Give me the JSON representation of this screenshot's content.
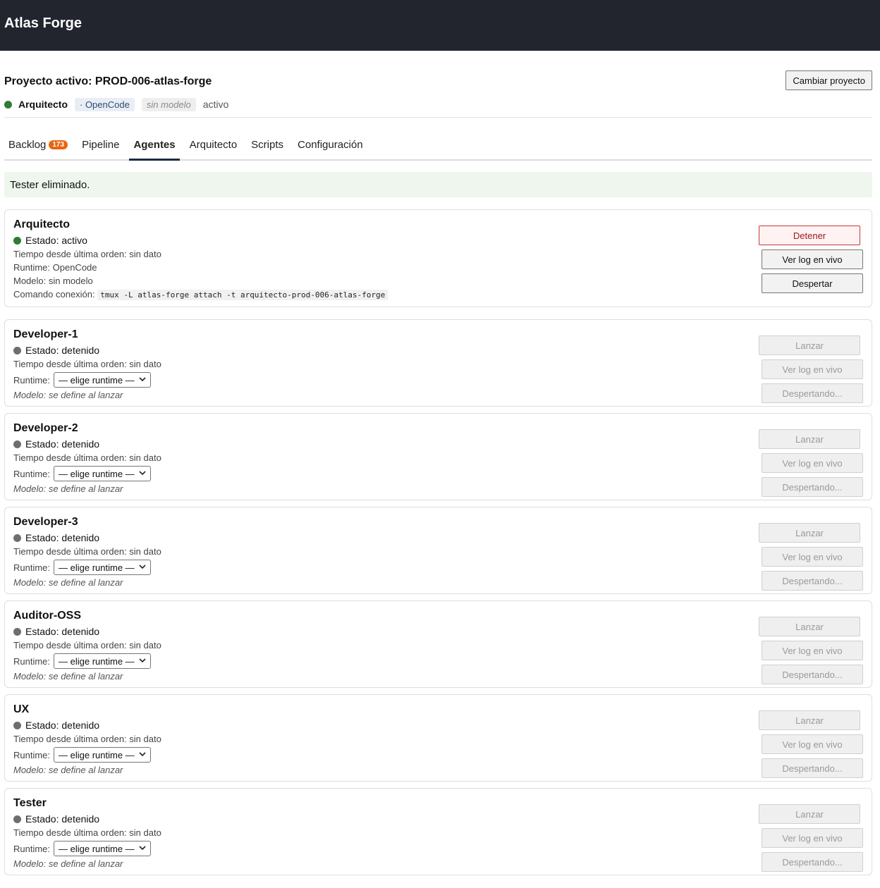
{
  "app": {
    "title": "Atlas Forge"
  },
  "project": {
    "active_label": "Proyecto activo: PROD-006-atlas-forge",
    "change_button": "Cambiar proyecto"
  },
  "status_bar": {
    "agent_name": "Arquitecto",
    "runtime_chip": "· OpenCode",
    "model_chip": "sin modelo",
    "state": "activo"
  },
  "tabs": [
    {
      "label": "Backlog",
      "badge": "173"
    },
    {
      "label": "Pipeline"
    },
    {
      "label": "Agentes",
      "active": true
    },
    {
      "label": "Arquitecto"
    },
    {
      "label": "Scripts"
    },
    {
      "label": "Configuración"
    }
  ],
  "notice": "Tester eliminado.",
  "labels": {
    "select_placeholder": "— elige runtime —",
    "runtime_prefix": "Runtime:",
    "model_note": "Modelo: se define al lanzar",
    "time_line": "Tiempo desde última orden: sin dato",
    "btn_launch": "Lanzar",
    "btn_log": "Ver log en vivo",
    "btn_waking": "Despertando..."
  },
  "architect": {
    "name": "Arquitecto",
    "state": "Estado: activo",
    "time": "Tiempo desde última orden: sin dato",
    "runtime": "Runtime: OpenCode",
    "model": "Modelo: sin modelo",
    "cmd_label": "Comando conexión:",
    "cmd": "tmux -L atlas-forge attach -t arquitecto-prod-006-atlas-forge",
    "btn_stop": "Detener",
    "btn_log": "Ver log en vivo",
    "btn_wake": "Despertar"
  },
  "agents": [
    {
      "name": "Developer-1",
      "state": "Estado: detenido"
    },
    {
      "name": "Developer-2",
      "state": "Estado: detenido"
    },
    {
      "name": "Developer-3",
      "state": "Estado: detenido"
    },
    {
      "name": "Auditor-OSS",
      "state": "Estado: detenido"
    },
    {
      "name": "UX",
      "state": "Estado: detenido"
    },
    {
      "name": "Tester",
      "state": "Estado: detenido"
    }
  ],
  "colors": {
    "active": "#2e7d32",
    "stopped": "#6e6e6e",
    "badge": "#e8650f"
  },
  "icons": {
    "select_arrow": "chevron-down-icon",
    "status": "status-dot-icon"
  }
}
